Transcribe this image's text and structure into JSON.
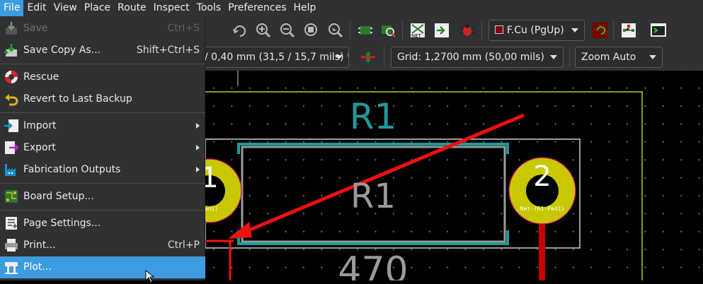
{
  "menubar": {
    "items": [
      "File",
      "Edit",
      "View",
      "Place",
      "Route",
      "Inspect",
      "Tools",
      "Preferences",
      "Help"
    ]
  },
  "toolbar": {
    "layer_select": "F.Cu (PgUp)",
    "track_width": "/ 0,40 mm (31,5 / 15,7 mils) *",
    "grid": "Grid: 1,2700 mm (50,00 mils)",
    "zoom": "Zoom Auto"
  },
  "file_menu": {
    "items": [
      {
        "label": "Save",
        "shortcut": "Ctrl+S",
        "icon": "save-icon"
      },
      {
        "label": "Save Copy As...",
        "shortcut": "Shift+Ctrl+S",
        "icon": "save-copy-icon"
      },
      {
        "label": "Rescue",
        "shortcut": "",
        "icon": "lifebuoy-icon"
      },
      {
        "label": "Revert to Last Backup",
        "shortcut": "",
        "icon": "revert-icon"
      },
      {
        "label": "Import",
        "shortcut": "",
        "icon": "import-icon"
      },
      {
        "label": "Export",
        "shortcut": "",
        "icon": "export-icon"
      },
      {
        "label": "Fabrication Outputs",
        "shortcut": "",
        "icon": "factory-icon"
      },
      {
        "label": "Board Setup...",
        "shortcut": "",
        "icon": "board-setup-icon"
      },
      {
        "label": "Page Settings...",
        "shortcut": "",
        "icon": "page-settings-icon"
      },
      {
        "label": "Print...",
        "shortcut": "Ctrl+P",
        "icon": "print-icon"
      },
      {
        "label": "Plot...",
        "shortcut": "",
        "icon": "plot-icon"
      }
    ]
  },
  "pcb": {
    "ref_top": "R1",
    "ref_body": "R1",
    "value": "470",
    "pad1_number": "1",
    "pad2_number": "2",
    "pad1_net": "Pad1)",
    "pad2_net": "Net-(R1-Pad1)"
  },
  "colors": {
    "menu_bg": "#2f3133",
    "highlight": "#3d9be0",
    "pad": "#c8c800",
    "silkscreen_ref": "#1f9a9a",
    "fab": "#9a9a9a",
    "track": "#c80000",
    "board_outline": "#c8c800"
  }
}
